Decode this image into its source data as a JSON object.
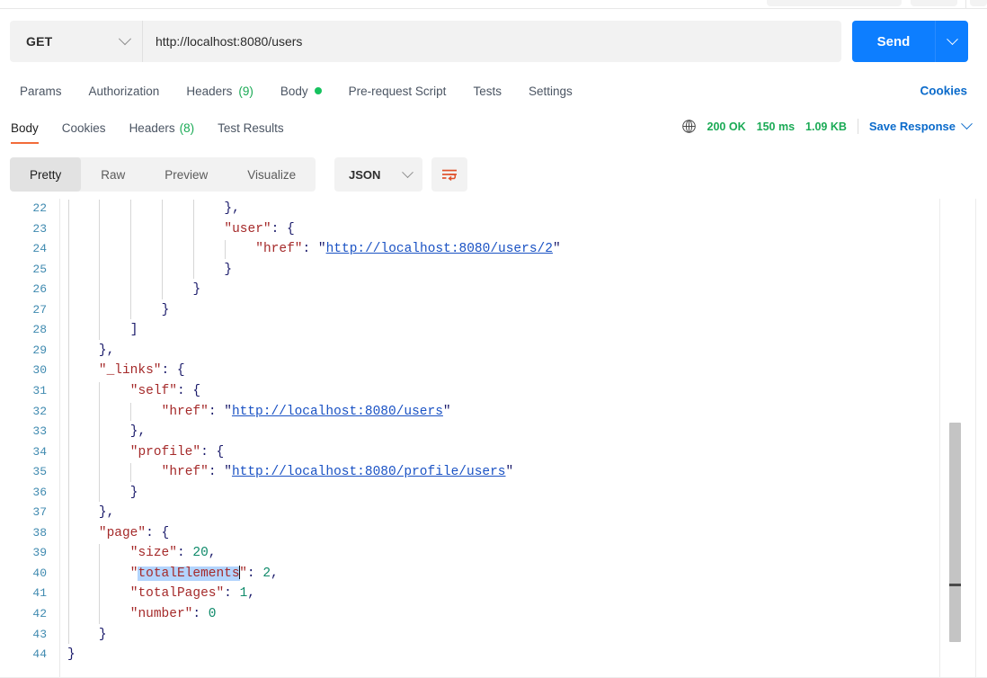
{
  "request": {
    "method": "GET",
    "method_icon": "chevron-down-icon",
    "url": "http://localhost:8080/users",
    "send_label": "Send",
    "send_caret_icon": "chevron-down-icon",
    "tabs": [
      {
        "label": "Params",
        "badge": "",
        "dot": false
      },
      {
        "label": "Authorization",
        "badge": "",
        "dot": false
      },
      {
        "label": "Headers",
        "badge": "(9)",
        "dot": false
      },
      {
        "label": "Body",
        "badge": "",
        "dot": true
      },
      {
        "label": "Pre-request Script",
        "badge": "",
        "dot": false
      },
      {
        "label": "Tests",
        "badge": "",
        "dot": false
      },
      {
        "label": "Settings",
        "badge": "",
        "dot": false
      }
    ],
    "cookies_link": "Cookies"
  },
  "response": {
    "tabs": [
      {
        "label": "Body",
        "badge": "",
        "active": true
      },
      {
        "label": "Cookies",
        "badge": "",
        "active": false
      },
      {
        "label": "Headers",
        "badge": "(8)",
        "active": false
      },
      {
        "label": "Test Results",
        "badge": "",
        "active": false
      }
    ],
    "status": {
      "globe_icon": "globe-icon",
      "code": "200 OK",
      "time": "150 ms",
      "size": "1.09 KB"
    },
    "save_response": "Save Response",
    "save_caret_icon": "chevron-down-icon",
    "view_modes": [
      {
        "label": "Pretty",
        "active": true
      },
      {
        "label": "Raw",
        "active": false
      },
      {
        "label": "Preview",
        "active": false
      },
      {
        "label": "Visualize",
        "active": false
      }
    ],
    "format": "JSON",
    "format_caret_icon": "chevron-down-icon",
    "wrap_icon": "wrap-lines-icon",
    "copy_icon": "copy-icon",
    "search_icon": "search-icon"
  },
  "colors": {
    "accent_blue": "#0d7eff",
    "link_blue": "#0b6bcb",
    "status_green": "#1aaa55",
    "tab_underline_orange": "#f26b3a",
    "wrap_icon_orange": "#e0502a",
    "json_key": "#a52a2a",
    "json_number": "#0f8a6a",
    "json_url": "#1a52c4",
    "line_number": "#3f8ab0",
    "selection": "#b3d4fd"
  },
  "code": {
    "first_line_number": 22,
    "lines": [
      {
        "n": 22,
        "indent": 5,
        "tokens": [
          {
            "t": "}",
            "c": "p"
          },
          {
            "t": ",",
            "c": "p"
          }
        ]
      },
      {
        "n": 23,
        "indent": 5,
        "tokens": [
          {
            "t": "\"user\"",
            "c": "k"
          },
          {
            "t": ": {",
            "c": "p"
          }
        ]
      },
      {
        "n": 24,
        "indent": 6,
        "tokens": [
          {
            "t": "\"href\"",
            "c": "k"
          },
          {
            "t": ": ",
            "c": "p"
          },
          {
            "t": "\"",
            "c": "p"
          },
          {
            "t": "http://localhost:8080/users/2",
            "c": "url"
          },
          {
            "t": "\"",
            "c": "p"
          }
        ]
      },
      {
        "n": 25,
        "indent": 5,
        "tokens": [
          {
            "t": "}",
            "c": "p"
          }
        ]
      },
      {
        "n": 26,
        "indent": 4,
        "tokens": [
          {
            "t": "}",
            "c": "p"
          }
        ]
      },
      {
        "n": 27,
        "indent": 3,
        "tokens": [
          {
            "t": "}",
            "c": "p"
          }
        ]
      },
      {
        "n": 28,
        "indent": 2,
        "tokens": [
          {
            "t": "]",
            "c": "p"
          }
        ]
      },
      {
        "n": 29,
        "indent": 1,
        "tokens": [
          {
            "t": "}",
            "c": "p"
          },
          {
            "t": ",",
            "c": "p"
          }
        ]
      },
      {
        "n": 30,
        "indent": 1,
        "tokens": [
          {
            "t": "\"_links\"",
            "c": "k"
          },
          {
            "t": ": {",
            "c": "p"
          }
        ]
      },
      {
        "n": 31,
        "indent": 2,
        "tokens": [
          {
            "t": "\"self\"",
            "c": "k"
          },
          {
            "t": ": {",
            "c": "p"
          }
        ]
      },
      {
        "n": 32,
        "indent": 3,
        "tokens": [
          {
            "t": "\"href\"",
            "c": "k"
          },
          {
            "t": ": ",
            "c": "p"
          },
          {
            "t": "\"",
            "c": "p"
          },
          {
            "t": "http://localhost:8080/users",
            "c": "url"
          },
          {
            "t": "\"",
            "c": "p"
          }
        ]
      },
      {
        "n": 33,
        "indent": 2,
        "tokens": [
          {
            "t": "}",
            "c": "p"
          },
          {
            "t": ",",
            "c": "p"
          }
        ]
      },
      {
        "n": 34,
        "indent": 2,
        "tokens": [
          {
            "t": "\"profile\"",
            "c": "k"
          },
          {
            "t": ": {",
            "c": "p"
          }
        ]
      },
      {
        "n": 35,
        "indent": 3,
        "tokens": [
          {
            "t": "\"href\"",
            "c": "k"
          },
          {
            "t": ": ",
            "c": "p"
          },
          {
            "t": "\"",
            "c": "p"
          },
          {
            "t": "http://localhost:8080/profile/users",
            "c": "url"
          },
          {
            "t": "\"",
            "c": "p"
          }
        ]
      },
      {
        "n": 36,
        "indent": 2,
        "tokens": [
          {
            "t": "}",
            "c": "p"
          }
        ]
      },
      {
        "n": 37,
        "indent": 1,
        "tokens": [
          {
            "t": "}",
            "c": "p"
          },
          {
            "t": ",",
            "c": "p"
          }
        ]
      },
      {
        "n": 38,
        "indent": 1,
        "tokens": [
          {
            "t": "\"page\"",
            "c": "k"
          },
          {
            "t": ": {",
            "c": "p"
          }
        ]
      },
      {
        "n": 39,
        "indent": 2,
        "tokens": [
          {
            "t": "\"size\"",
            "c": "k"
          },
          {
            "t": ": ",
            "c": "p"
          },
          {
            "t": "20",
            "c": "n"
          },
          {
            "t": ",",
            "c": "p"
          }
        ]
      },
      {
        "n": 40,
        "indent": 2,
        "tokens": [
          {
            "t": "\"",
            "c": "k"
          },
          {
            "t": "totalElements",
            "c": "k sel"
          },
          {
            "t": "CARET",
            "c": "caret"
          },
          {
            "t": "\"",
            "c": "k"
          },
          {
            "t": ": ",
            "c": "p"
          },
          {
            "t": "2",
            "c": "n"
          },
          {
            "t": ",",
            "c": "p"
          }
        ]
      },
      {
        "n": 41,
        "indent": 2,
        "tokens": [
          {
            "t": "\"totalPages\"",
            "c": "k"
          },
          {
            "t": ": ",
            "c": "p"
          },
          {
            "t": "1",
            "c": "n"
          },
          {
            "t": ",",
            "c": "p"
          }
        ]
      },
      {
        "n": 42,
        "indent": 2,
        "tokens": [
          {
            "t": "\"number\"",
            "c": "k"
          },
          {
            "t": ": ",
            "c": "p"
          },
          {
            "t": "0",
            "c": "n"
          }
        ]
      },
      {
        "n": 43,
        "indent": 1,
        "tokens": [
          {
            "t": "}",
            "c": "p"
          }
        ]
      },
      {
        "n": 44,
        "indent": 0,
        "tokens": [
          {
            "t": "}",
            "c": "p"
          }
        ]
      }
    ],
    "selected_text": "totalElements",
    "scrollbar": {
      "visible": true
    }
  }
}
